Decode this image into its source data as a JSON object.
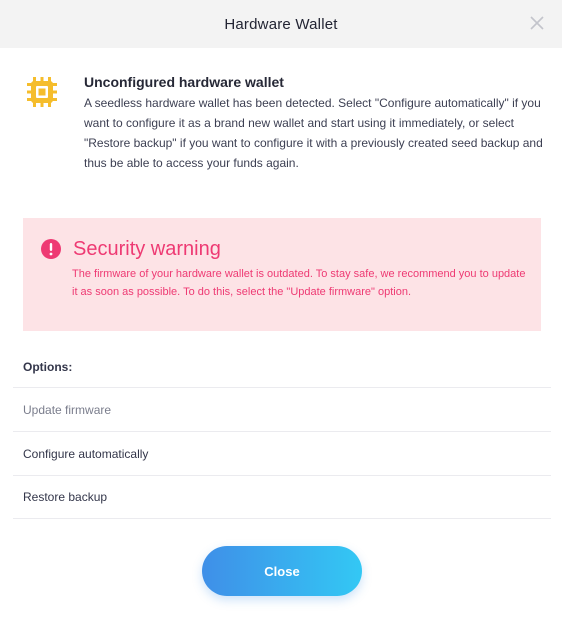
{
  "window": {
    "title": "Hardware Wallet"
  },
  "info": {
    "heading": "Unconfigured hardware wallet",
    "description": "A seedless hardware wallet has been detected. Select \"Configure automatically\" if you want to configure it as a brand new wallet and start using it immediately, or select \"Restore backup\" if you want to configure it with a previously created seed backup and thus be able to access your funds again.",
    "icon": "chip-icon"
  },
  "warning": {
    "title": "Security warning",
    "message": "The firmware of your hardware wallet is outdated. To stay safe, we recommend you to update it as soon as possible. To do this, select the \"Update firmware\" option.",
    "icon": "exclamation-icon"
  },
  "options": {
    "label": "Options:",
    "items": [
      {
        "label": "Update firmware"
      },
      {
        "label": "Configure automatically"
      },
      {
        "label": "Restore backup"
      }
    ]
  },
  "actions": {
    "close_label": "Close"
  },
  "colors": {
    "accent": "#3f8fe8",
    "warning": "#ee3a73",
    "warning_bg": "#fde3e6",
    "chip": "#f5bd2c"
  }
}
